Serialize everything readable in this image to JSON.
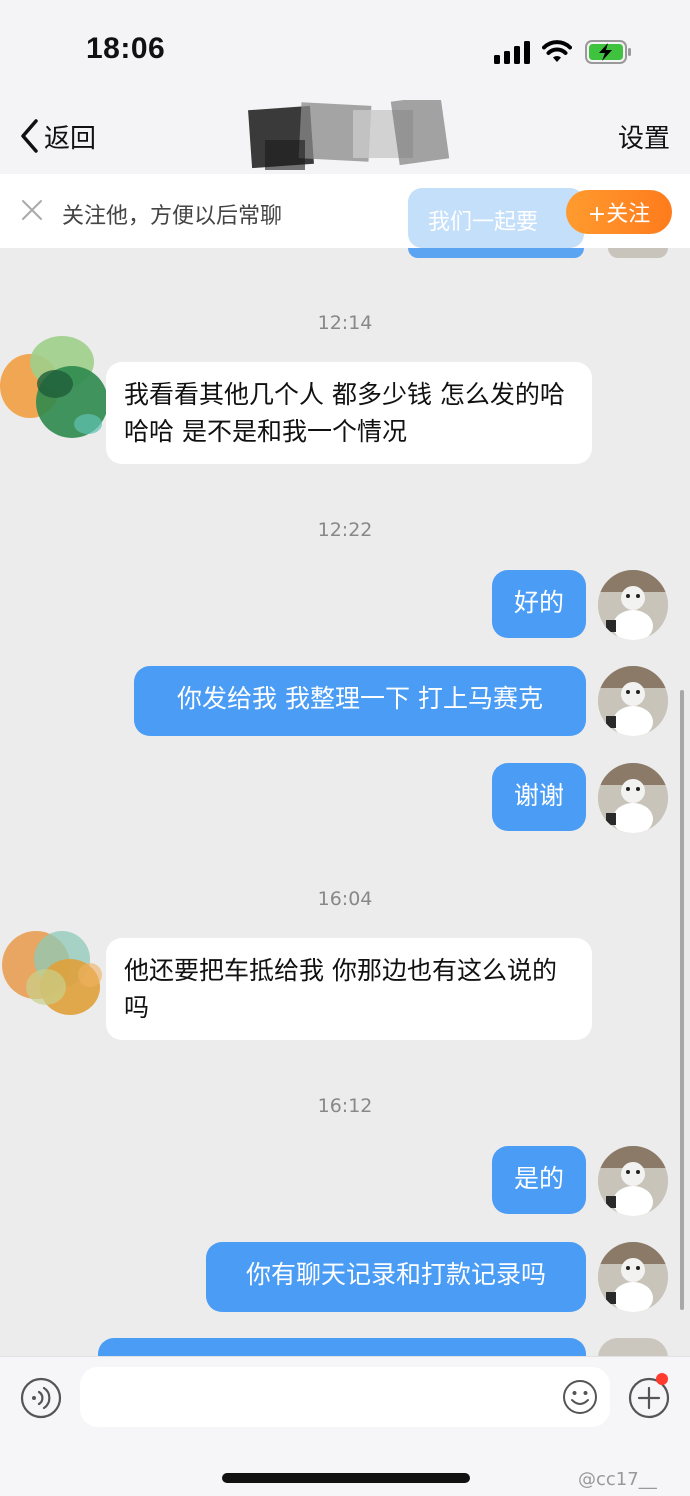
{
  "status_bar": {
    "time": "18:06"
  },
  "nav": {
    "back_label": "返回",
    "settings_label": "设置"
  },
  "follow_banner": {
    "text": "关注他，方便以后常聊",
    "button_label": "+关注",
    "peek_text": "我们一起要"
  },
  "messages": [
    {
      "timestamp": "12:14"
    },
    {
      "from": "them",
      "text": "我看看其他几个人 都多少钱 怎么发的哈哈哈  是不是和我一个情况"
    },
    {
      "timestamp": "12:22"
    },
    {
      "from": "me",
      "text": "好的"
    },
    {
      "from": "me",
      "text": "你发给我 我整理一下 打上马赛克"
    },
    {
      "from": "me",
      "text": "谢谢"
    },
    {
      "timestamp": "16:04"
    },
    {
      "from": "them",
      "text": "他还要把车抵给我  你那边也有这么说的吗"
    },
    {
      "timestamp": "16:12"
    },
    {
      "from": "me",
      "text": "是的"
    },
    {
      "from": "me",
      "text": "你有聊天记录和打款记录吗"
    }
  ],
  "input": {
    "placeholder": ""
  },
  "watermark": "@cc17__",
  "colors": {
    "outgoing_bubble": "#4a9cf5",
    "incoming_bubble": "#ffffff",
    "follow_button": "#ff8a25",
    "chat_background": "#ececec"
  }
}
